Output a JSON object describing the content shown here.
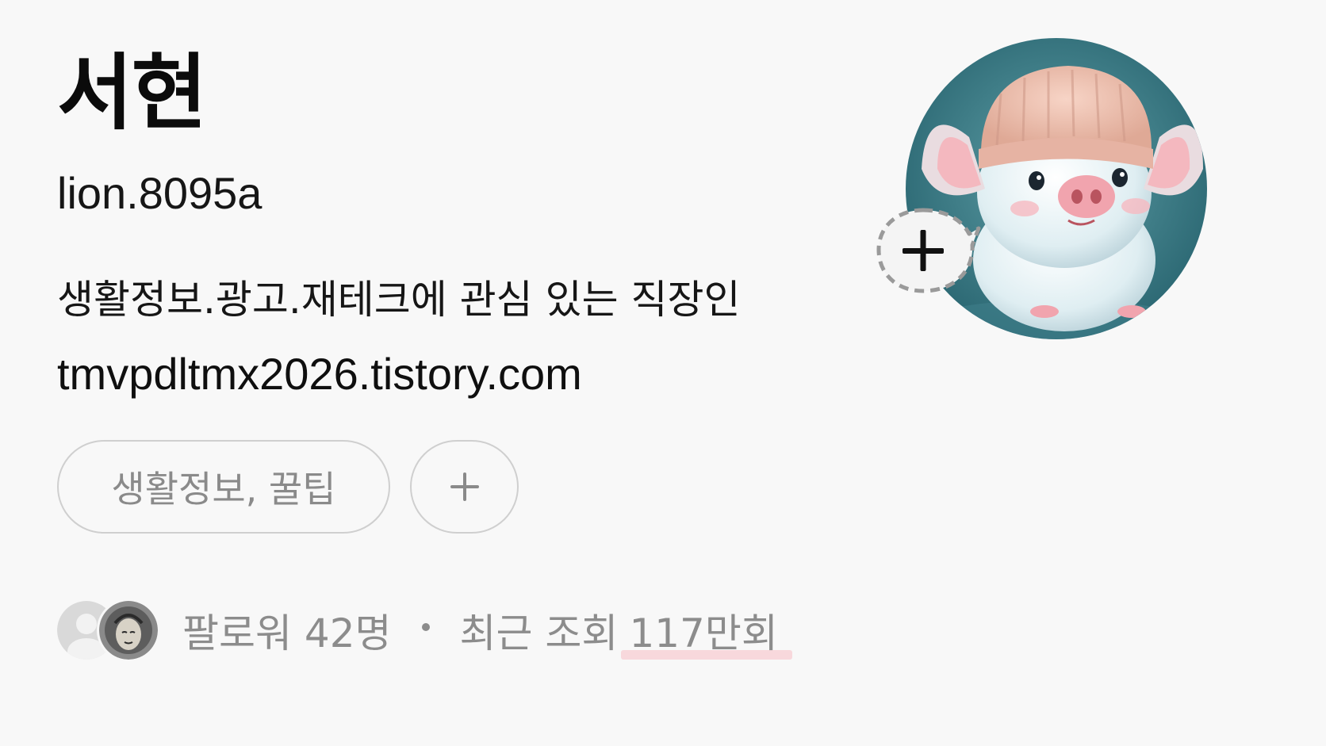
{
  "profile": {
    "display_name": "서현",
    "username": "lion.8095a",
    "bio": "생활정보.광고.재테크에 관심 있는 직장인",
    "link": "tmvpdltmx2026.tistory.com",
    "avatar_icon": "pig-in-knit-hat-avatar",
    "add_note_icon": "plus-icon"
  },
  "tags": {
    "items": [
      "생활정보, 꿀팁"
    ],
    "add_icon": "plus-icon"
  },
  "stats": {
    "followers_label": "팔로워 42명",
    "separator_icon": "dot-icon",
    "views_prefix": "최근 조회",
    "views_value": "117만회",
    "follower_avatar_icons": [
      "default-user-avatar",
      "illustrated-face-avatar"
    ]
  },
  "colors": {
    "background": "#f8f8f8",
    "primary_text": "#111111",
    "muted_text": "#8c8c8c",
    "chip_border": "#cfcfcf",
    "highlight": "#f8d8dc"
  }
}
